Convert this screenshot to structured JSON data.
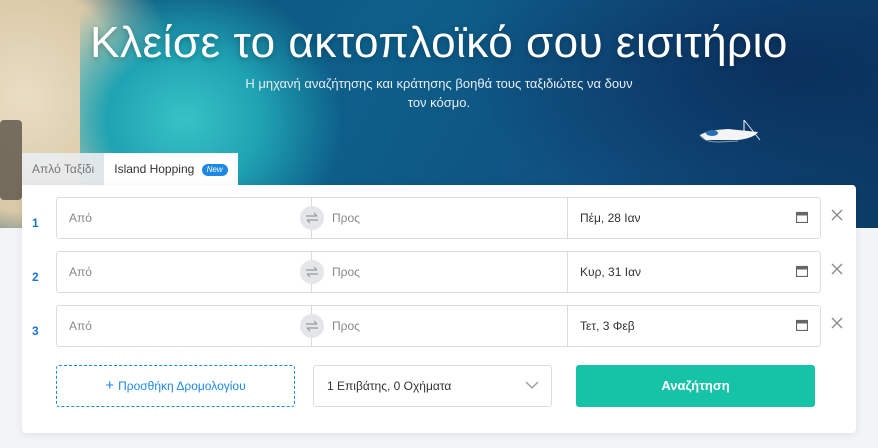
{
  "hero": {
    "title": "Κλείσε το ακτοπλοϊκό σου εισιτήριο",
    "subtitle": "Η μηχανή αναζήτησης και κράτησης βοηθά τους ταξιδιώτες να δουν τον κόσμο."
  },
  "tabs": [
    {
      "label": "Απλό Ταξίδι",
      "active": false
    },
    {
      "label": "Island Hopping",
      "active": true,
      "badge": "New"
    }
  ],
  "routes": [
    {
      "number": "1",
      "from_placeholder": "Από",
      "to_placeholder": "Προς",
      "date": "Πέμ, 28 Ιαν"
    },
    {
      "number": "2",
      "from_placeholder": "Από",
      "to_placeholder": "Προς",
      "date": "Κυρ, 31 Ιαν"
    },
    {
      "number": "3",
      "from_placeholder": "Από",
      "to_placeholder": "Προς",
      "date": "Τετ, 3 Φεβ"
    }
  ],
  "actions": {
    "add_route_label": "Προσθήκη Δρομολογίου",
    "passengers_value": "1 Επιβάτης, 0 Οχήματα",
    "search_label": "Αναζήτηση"
  },
  "icons": {
    "swap": "swap-icon",
    "calendar": "calendar-icon",
    "remove": "close-icon",
    "chevron": "chevron-down-icon",
    "plus": "plus-icon"
  },
  "colors": {
    "accent": "#1e88e5",
    "search_button": "#17c3a7",
    "route_number": "#1976d2"
  }
}
